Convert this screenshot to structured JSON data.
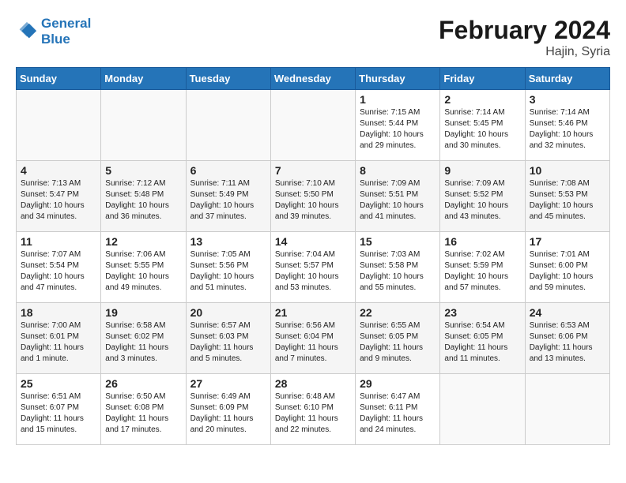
{
  "logo": {
    "line1": "General",
    "line2": "Blue"
  },
  "title": "February 2024",
  "subtitle": "Hajin, Syria",
  "weekdays": [
    "Sunday",
    "Monday",
    "Tuesday",
    "Wednesday",
    "Thursday",
    "Friday",
    "Saturday"
  ],
  "weeks": [
    [
      {
        "day": "",
        "info": ""
      },
      {
        "day": "",
        "info": ""
      },
      {
        "day": "",
        "info": ""
      },
      {
        "day": "",
        "info": ""
      },
      {
        "day": "1",
        "info": "Sunrise: 7:15 AM\nSunset: 5:44 PM\nDaylight: 10 hours\nand 29 minutes."
      },
      {
        "day": "2",
        "info": "Sunrise: 7:14 AM\nSunset: 5:45 PM\nDaylight: 10 hours\nand 30 minutes."
      },
      {
        "day": "3",
        "info": "Sunrise: 7:14 AM\nSunset: 5:46 PM\nDaylight: 10 hours\nand 32 minutes."
      }
    ],
    [
      {
        "day": "4",
        "info": "Sunrise: 7:13 AM\nSunset: 5:47 PM\nDaylight: 10 hours\nand 34 minutes."
      },
      {
        "day": "5",
        "info": "Sunrise: 7:12 AM\nSunset: 5:48 PM\nDaylight: 10 hours\nand 36 minutes."
      },
      {
        "day": "6",
        "info": "Sunrise: 7:11 AM\nSunset: 5:49 PM\nDaylight: 10 hours\nand 37 minutes."
      },
      {
        "day": "7",
        "info": "Sunrise: 7:10 AM\nSunset: 5:50 PM\nDaylight: 10 hours\nand 39 minutes."
      },
      {
        "day": "8",
        "info": "Sunrise: 7:09 AM\nSunset: 5:51 PM\nDaylight: 10 hours\nand 41 minutes."
      },
      {
        "day": "9",
        "info": "Sunrise: 7:09 AM\nSunset: 5:52 PM\nDaylight: 10 hours\nand 43 minutes."
      },
      {
        "day": "10",
        "info": "Sunrise: 7:08 AM\nSunset: 5:53 PM\nDaylight: 10 hours\nand 45 minutes."
      }
    ],
    [
      {
        "day": "11",
        "info": "Sunrise: 7:07 AM\nSunset: 5:54 PM\nDaylight: 10 hours\nand 47 minutes."
      },
      {
        "day": "12",
        "info": "Sunrise: 7:06 AM\nSunset: 5:55 PM\nDaylight: 10 hours\nand 49 minutes."
      },
      {
        "day": "13",
        "info": "Sunrise: 7:05 AM\nSunset: 5:56 PM\nDaylight: 10 hours\nand 51 minutes."
      },
      {
        "day": "14",
        "info": "Sunrise: 7:04 AM\nSunset: 5:57 PM\nDaylight: 10 hours\nand 53 minutes."
      },
      {
        "day": "15",
        "info": "Sunrise: 7:03 AM\nSunset: 5:58 PM\nDaylight: 10 hours\nand 55 minutes."
      },
      {
        "day": "16",
        "info": "Sunrise: 7:02 AM\nSunset: 5:59 PM\nDaylight: 10 hours\nand 57 minutes."
      },
      {
        "day": "17",
        "info": "Sunrise: 7:01 AM\nSunset: 6:00 PM\nDaylight: 10 hours\nand 59 minutes."
      }
    ],
    [
      {
        "day": "18",
        "info": "Sunrise: 7:00 AM\nSunset: 6:01 PM\nDaylight: 11 hours\nand 1 minute."
      },
      {
        "day": "19",
        "info": "Sunrise: 6:58 AM\nSunset: 6:02 PM\nDaylight: 11 hours\nand 3 minutes."
      },
      {
        "day": "20",
        "info": "Sunrise: 6:57 AM\nSunset: 6:03 PM\nDaylight: 11 hours\nand 5 minutes."
      },
      {
        "day": "21",
        "info": "Sunrise: 6:56 AM\nSunset: 6:04 PM\nDaylight: 11 hours\nand 7 minutes."
      },
      {
        "day": "22",
        "info": "Sunrise: 6:55 AM\nSunset: 6:05 PM\nDaylight: 11 hours\nand 9 minutes."
      },
      {
        "day": "23",
        "info": "Sunrise: 6:54 AM\nSunset: 6:05 PM\nDaylight: 11 hours\nand 11 minutes."
      },
      {
        "day": "24",
        "info": "Sunrise: 6:53 AM\nSunset: 6:06 PM\nDaylight: 11 hours\nand 13 minutes."
      }
    ],
    [
      {
        "day": "25",
        "info": "Sunrise: 6:51 AM\nSunset: 6:07 PM\nDaylight: 11 hours\nand 15 minutes."
      },
      {
        "day": "26",
        "info": "Sunrise: 6:50 AM\nSunset: 6:08 PM\nDaylight: 11 hours\nand 17 minutes."
      },
      {
        "day": "27",
        "info": "Sunrise: 6:49 AM\nSunset: 6:09 PM\nDaylight: 11 hours\nand 20 minutes."
      },
      {
        "day": "28",
        "info": "Sunrise: 6:48 AM\nSunset: 6:10 PM\nDaylight: 11 hours\nand 22 minutes."
      },
      {
        "day": "29",
        "info": "Sunrise: 6:47 AM\nSunset: 6:11 PM\nDaylight: 11 hours\nand 24 minutes."
      },
      {
        "day": "",
        "info": ""
      },
      {
        "day": "",
        "info": ""
      }
    ]
  ]
}
